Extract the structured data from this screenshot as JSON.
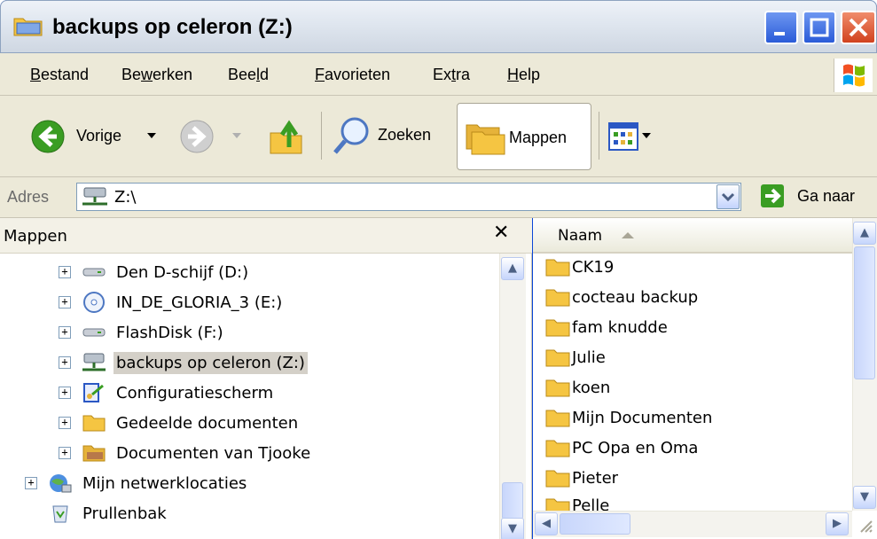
{
  "window": {
    "title": "backups op celeron (Z:)"
  },
  "menu": {
    "items": [
      "Bestand",
      "Bewerken",
      "Beeld",
      "Favorieten",
      "Extra",
      "Help"
    ],
    "underline": [
      "B",
      "w",
      "l",
      "F",
      "t",
      "H"
    ]
  },
  "toolbar": {
    "back_label": "Vorige",
    "search_label": "Zoeken",
    "folders_label": "Mappen"
  },
  "address": {
    "label": "Adres",
    "value": "Z:\\",
    "go_label": "Ga naar"
  },
  "folders_pane": {
    "title": "Mappen",
    "close_glyph": "✕",
    "tree": [
      {
        "label": "Den D-schijf (D:)",
        "icon": "drive-icon"
      },
      {
        "label": "IN_DE_GLORIA_3 (E:)",
        "icon": "cd-drive-icon"
      },
      {
        "label": "FlashDisk (F:)",
        "icon": "drive-icon"
      },
      {
        "label": "backups op celeron (Z:)",
        "icon": "network-drive-icon",
        "selected": true
      },
      {
        "label": "Configuratiescherm",
        "icon": "control-panel-icon"
      },
      {
        "label": "Gedeelde documenten",
        "icon": "folder-icon"
      },
      {
        "label": "Documenten van Tjooke",
        "icon": "folder-open-icon"
      },
      {
        "label": "Mijn netwerklocaties",
        "icon": "network-places-icon"
      },
      {
        "label": "Prullenbak",
        "icon": "recycle-bin-icon"
      }
    ]
  },
  "file_list": {
    "column_name": "Naam",
    "items": [
      "CK19",
      "cocteau backup",
      "fam knudde",
      "Julie",
      "koen",
      "Mijn Documenten",
      "PC Opa en Oma",
      "Pieter",
      "Pelle"
    ]
  },
  "colors": {
    "title_bar": "#dfe6ef",
    "chrome": "#ece9d8",
    "selection": "#d4d0c8",
    "folder": "#f5c542",
    "go_arrow": "#3a9d23",
    "back_arrow": "#3a9d23"
  }
}
